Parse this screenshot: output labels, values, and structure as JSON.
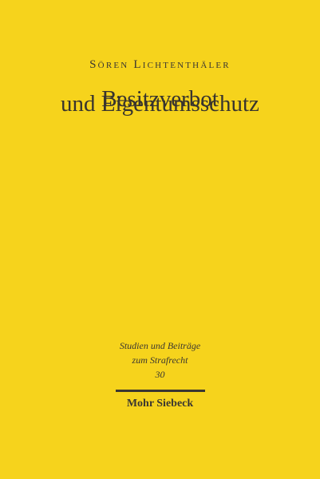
{
  "cover": {
    "author": "Sören Lichtenthäler",
    "title_line1": "Besitzverbot",
    "title_line2": "und Eigentumsschutz",
    "series_line1": "Studien und Beiträge",
    "series_line2": "zum Strafrecht",
    "series_number": "30",
    "publisher": "Mohr Siebeck",
    "background_color": "#f6d31c",
    "text_color": "#3b3731"
  }
}
